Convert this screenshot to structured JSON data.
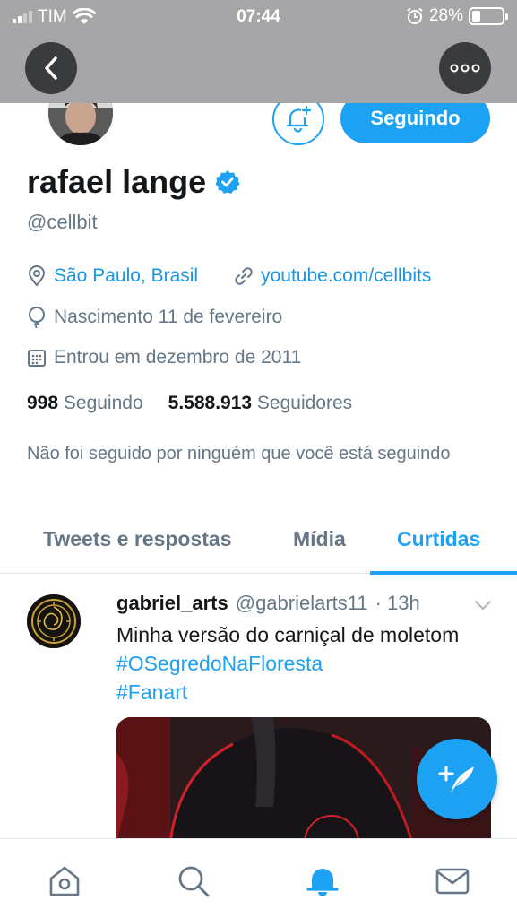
{
  "status_bar": {
    "carrier": "TIM",
    "time": "07:44",
    "battery": "28%",
    "battery_level": 0.28
  },
  "header": {
    "back_icon": "chevron-left-icon",
    "more_icon": "more-horizontal-icon"
  },
  "profile": {
    "name": "rafael lange",
    "handle": "@cellbit",
    "verified_icon": "verified-badge-icon",
    "follow_button_label": "Seguindo",
    "notify_icon": "bell-plus-icon",
    "location": "São Paulo, Brasil",
    "website": "youtube.com/cellbits",
    "birthday": "Nascimento 11 de fevereiro",
    "joined": "Entrou em dezembro de 2011",
    "following_count": "998",
    "following_label": "Seguindo",
    "followers_count": "5.588.913",
    "followers_label": "Seguidores",
    "followed_by_note": "Não foi seguido por ninguém que você está seguindo"
  },
  "tabs": [
    {
      "label": "Tweets e respostas",
      "active": false
    },
    {
      "label": "Mídia",
      "active": false
    },
    {
      "label": "Curtidas",
      "active": true
    }
  ],
  "tweet": {
    "author_name": "gabriel_arts",
    "author_handle": "@gabrielarts11",
    "time": "· 13h",
    "text": "Minha versão do carniçal de moletom ",
    "hashtag_1": "#OSegredoNaFloresta",
    "hashtag_2": "#Fanart"
  },
  "fab": {
    "icon": "compose-tweet-icon"
  },
  "bottom_nav": [
    {
      "icon": "home-icon"
    },
    {
      "icon": "search-icon"
    },
    {
      "icon": "notifications-icon",
      "active": true
    },
    {
      "icon": "messages-icon"
    }
  ],
  "colors": {
    "accent": "#1da1f2",
    "link": "#1b95e0",
    "secondary_text": "#657786",
    "header_bg": "#a6a6a8"
  }
}
